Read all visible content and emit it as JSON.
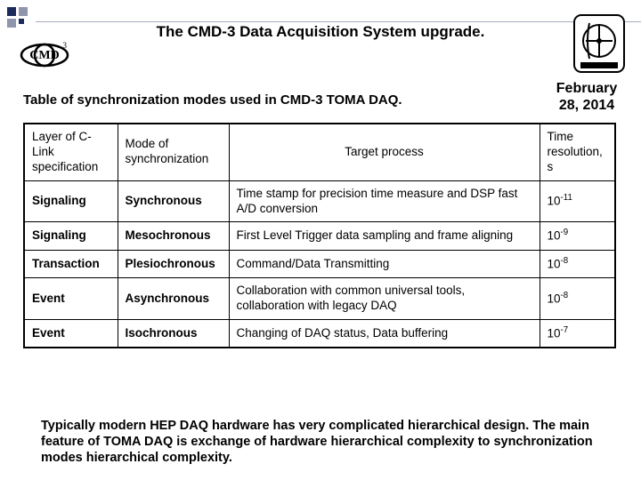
{
  "header": {
    "title": "The CMD-3 Data Acquisition System upgrade."
  },
  "date": "February 28, 2014",
  "subtitle": "Table of synchronization modes used in CMD-3 TOMA DAQ.",
  "table": {
    "columns": [
      "Layer of C-Link specification",
      "Mode of synchronization",
      "Target process",
      "Time resolution, s"
    ],
    "rows": [
      {
        "layer": "Signaling",
        "mode": "Synchronous",
        "target": "Time stamp for precision time measure and DSP fast A/D conversion",
        "res_base": "10",
        "res_exp": "-11"
      },
      {
        "layer": "Signaling",
        "mode": "Mesochronous",
        "target": "First Level Trigger data sampling and frame aligning",
        "res_base": "10",
        "res_exp": "-9"
      },
      {
        "layer": "Transaction",
        "mode": "Plesiochronous",
        "target": "Command/Data Transmitting",
        "res_base": "10",
        "res_exp": "-8"
      },
      {
        "layer": "Event",
        "mode": "Asynchronous",
        "target": "Collaboration with common universal tools, collaboration with legacy DAQ",
        "res_base": "10",
        "res_exp": "-8"
      },
      {
        "layer": "Event",
        "mode": "Isochronous",
        "target": "Changing of DAQ status, Data buffering",
        "res_base": "10",
        "res_exp": "-7"
      }
    ]
  },
  "footer": "Typically modern HEP DAQ hardware has very complicated hierarchical design. The main feature of TOMA DAQ is exchange of hardware hierarchical complexity to synchronization modes hierarchical complexity."
}
